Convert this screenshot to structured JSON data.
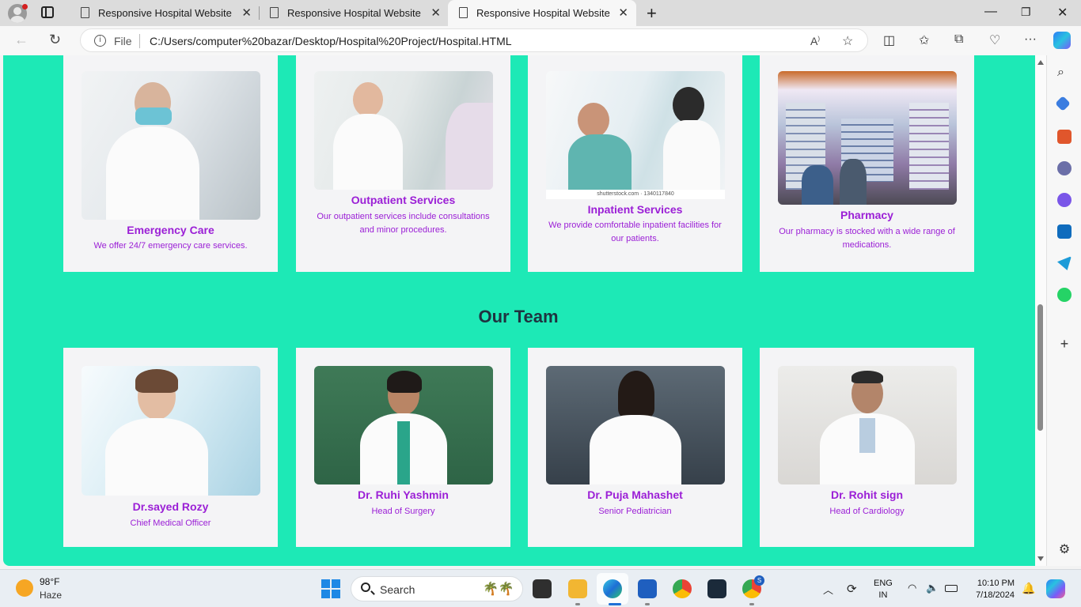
{
  "browser": {
    "tabs": [
      {
        "title": "Responsive Hospital Website",
        "active": false
      },
      {
        "title": "Responsive Hospital Website",
        "active": false
      },
      {
        "title": "Responsive Hospital Website",
        "active": true
      }
    ],
    "address": {
      "scheme_label": "File",
      "url": "C:/Users/computer%20bazar/Desktop/Hospital%20Project/Hospital.HTML"
    }
  },
  "services": [
    {
      "title": "Emergency Care",
      "description": "We offer 24/7 emergency care services."
    },
    {
      "title": "Outpatient Services",
      "description": "Our outpatient services include consultations and minor procedures."
    },
    {
      "title": "Inpatient Services",
      "description": "We provide comfortable inpatient facilities for our patients."
    },
    {
      "title": "Pharmacy",
      "description": "Our pharmacy is stocked with a wide range of medications."
    }
  ],
  "team": {
    "heading": "Our Team",
    "members": [
      {
        "name": "Dr.sayed Rozy",
        "role": "Chief Medical Officer"
      },
      {
        "name": "Dr. Ruhi Yashmin",
        "role": "Head of Surgery"
      },
      {
        "name": "Dr. Puja Mahashet",
        "role": "Senior Pediatrician"
      },
      {
        "name": "Dr. Rohit sign",
        "role": "Head of Cardiology"
      }
    ]
  },
  "inpatient_photo_caption": "shutterstock.com · 1340117840",
  "colors": {
    "page_background": "#1de9b6",
    "card_background": "#f4f4f6",
    "accent_text": "#9b1fd6",
    "heading_text": "#1f3340"
  },
  "taskbar": {
    "weather": {
      "temp": "98°F",
      "condition": "Haze"
    },
    "search_placeholder": "Search",
    "language": {
      "line1": "ENG",
      "line2": "IN"
    },
    "clock": {
      "time": "10:10 PM",
      "date": "7/18/2024"
    },
    "chrome_badge": "S"
  }
}
